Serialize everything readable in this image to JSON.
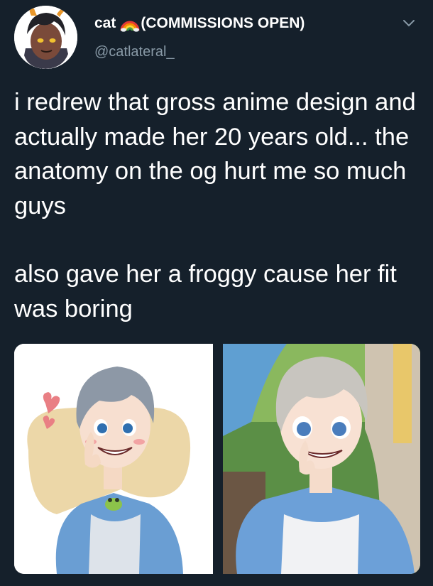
{
  "tweet": {
    "display_name_prefix": "cat",
    "display_name_suffix": "(COMMISSIONS OPEN)",
    "rainbow_emoji": "rainbow-icon",
    "handle": "@catlateral_",
    "text_paragraph_1": "i redrew that gross anime design and actually made her 20 years old... the anatomy on the og hurt me so much guys",
    "text_paragraph_2": "also gave her a froggy cause her fit was boring"
  },
  "media": {
    "left_image": "redrawn-anime-girl-with-frog-shirt-illustration",
    "right_image": "original-anime-screenshot"
  },
  "colors": {
    "background": "#15202b",
    "text_primary": "#ffffff",
    "text_secondary": "#8899a6"
  }
}
